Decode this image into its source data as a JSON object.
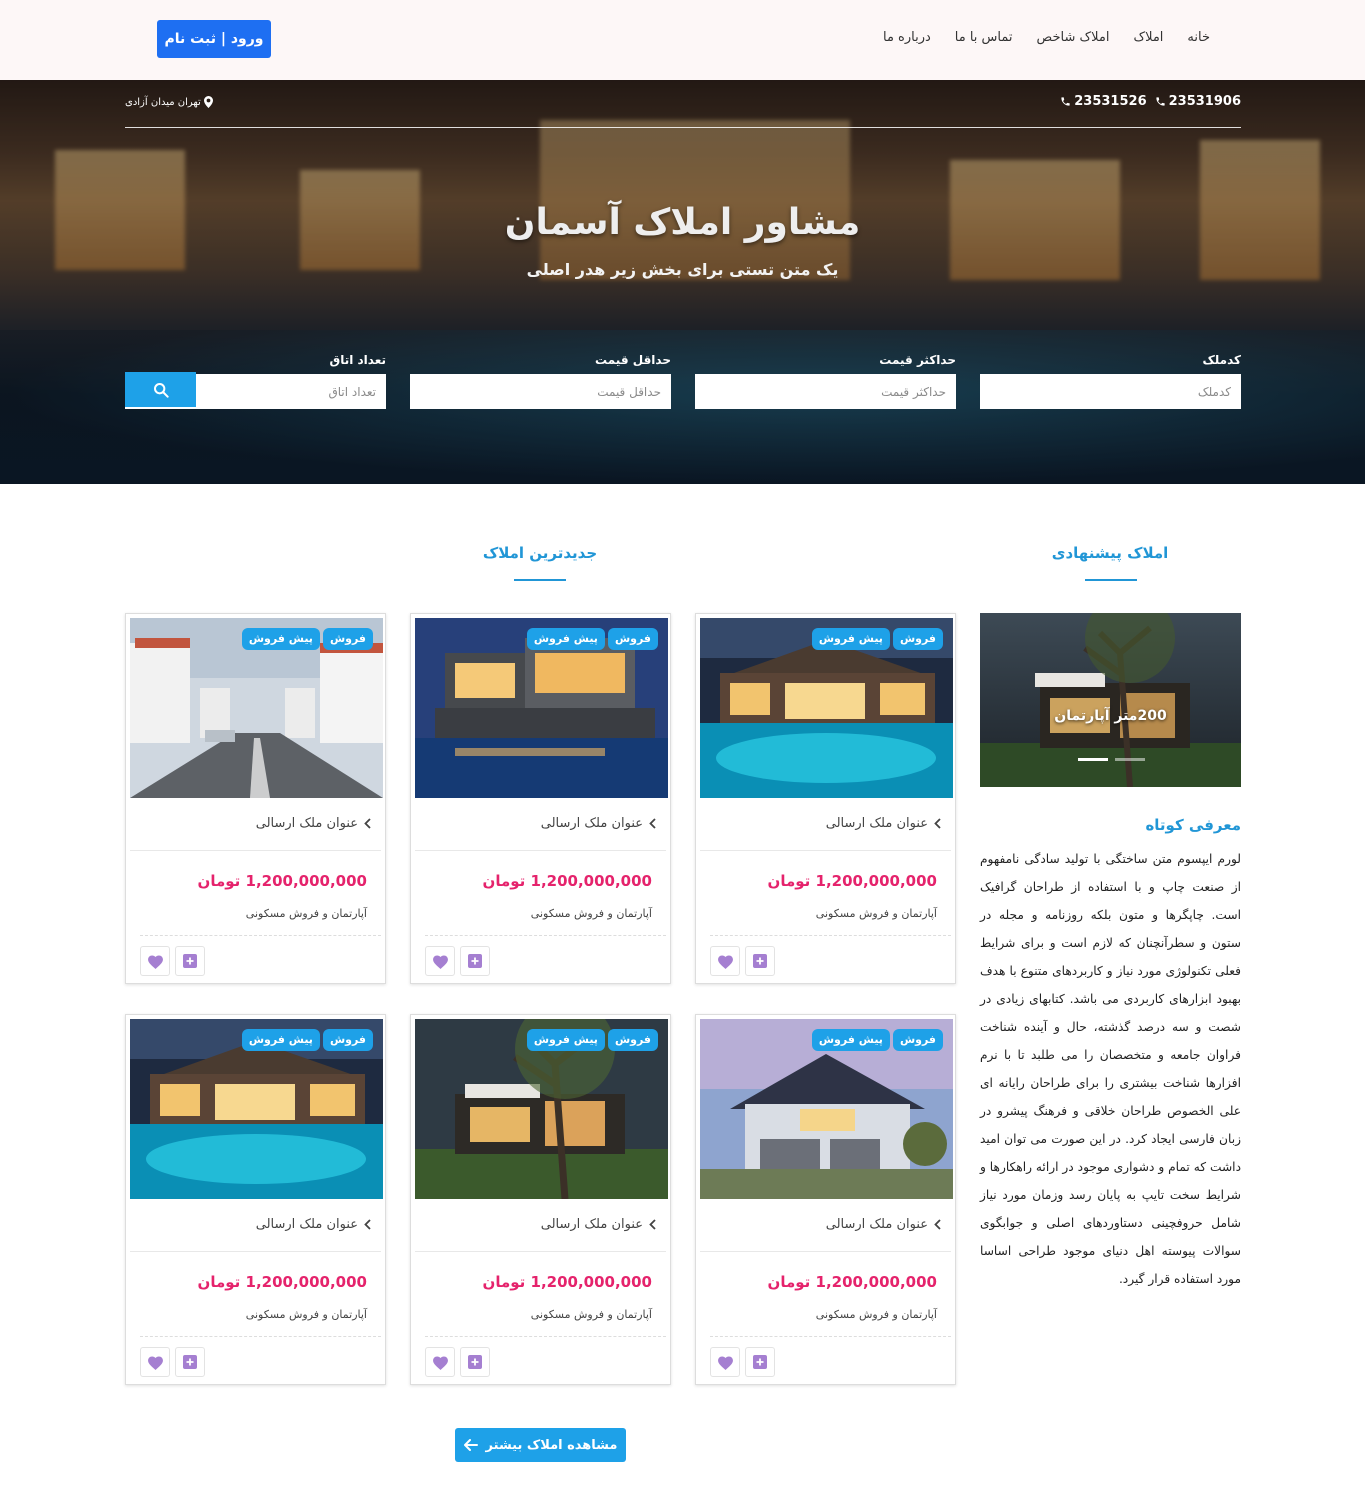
{
  "nav": {
    "items": [
      "خانه",
      "املاک",
      "املاک شاخص",
      "تماس با ما",
      "درباره ما"
    ],
    "login_label": "ورود | ثبت نام"
  },
  "hero": {
    "phones": [
      "23531906",
      "23531526"
    ],
    "address": "تهران میدان آزادی",
    "title": "مشاور املاک آسمان",
    "subtitle": "یک متن تستی برای بخش زیر هدر اصلی",
    "search": {
      "fields": [
        {
          "label": "کدملک",
          "placeholder": "کدملک"
        },
        {
          "label": "حداکثر قیمت",
          "placeholder": "حداکثر قیمت"
        },
        {
          "label": "حداقل قیمت",
          "placeholder": "حداقل قیمت"
        },
        {
          "label": "تعداد اتاق",
          "placeholder": "تعداد اتاق"
        }
      ]
    }
  },
  "sections": {
    "suggested": "املاک پیشنهادی",
    "newest": "جدیدترین املاک"
  },
  "colors": {
    "accent": "#1ea1e8",
    "primary_button": "#1e6ff2",
    "price": "#e5236c",
    "action_icon": "#a57fd1"
  },
  "cards": [
    {
      "scene": "villa-pool",
      "badges": [
        "فروش",
        "پیش فروش"
      ],
      "title": "عنوان ملک ارسالی",
      "price": "1,200,000,000 تومان",
      "type": "آپارتمان و فروش مسکونی"
    },
    {
      "scene": "modern-pool",
      "badges": [
        "فروش",
        "پیش فروش"
      ],
      "title": "عنوان ملک ارسالی",
      "price": "1,200,000,000 تومان",
      "type": "آپارتمان و فروش مسکونی"
    },
    {
      "scene": "white-street",
      "badges": [
        "فروش",
        "پیش فروش"
      ],
      "title": "عنوان ملک ارسالی",
      "price": "1,200,000,000 تومان",
      "type": "آپارتمان و فروش مسکونی"
    },
    {
      "scene": "blue-house",
      "badges": [
        "فروش",
        "پیش فروش"
      ],
      "title": "عنوان ملک ارسالی",
      "price": "1,200,000,000 تومان",
      "type": "آپارتمان و فروش مسکونی"
    },
    {
      "scene": "tree-house",
      "badges": [
        "فروش",
        "پیش فروش"
      ],
      "title": "عنوان ملک ارسالی",
      "price": "1,200,000,000 تومان",
      "type": "آپارتمان و فروش مسکونی"
    },
    {
      "scene": "villa-pool",
      "badges": [
        "فروش",
        "پیش فروش"
      ],
      "title": "عنوان ملک ارسالی",
      "price": "1,200,000,000 تومان",
      "type": "آپارتمان و فروش مسکونی"
    }
  ],
  "slider": {
    "caption": "200متر آپارتمان",
    "slides": 2,
    "active_slide": 2
  },
  "intro": {
    "heading": "معرفی کوتاه",
    "text": "لورم ایپسوم متن ساختگی با تولید سادگی نامفهوم از صنعت چاپ و با استفاده از طراحان گرافیک است. چاپگرها و متون بلکه روزنامه و مجله در ستون و سطرآنچنان که لازم است و برای شرایط فعلی تکنولوژی مورد نیاز و کاربردهای متنوع با هدف بهبود ابزارهای کاربردی می باشد. کتابهای زیادی در شصت و سه درصد گذشته، حال و آینده شناخت فراوان جامعه و متخصصان را می طلبد تا با نرم افزارها شناخت بیشتری را برای طراحان رایانه ای علی الخصوص طراحان خلاقی و فرهنگ پیشرو در زبان فارسی ایجاد کرد. در این صورت می توان امید داشت که تمام و دشواری موجود در ارائه راهکارها و شرایط سخت تایپ به پایان رسد وزمان مورد نیاز شامل حروفچینی دستاوردهای اصلی و جوابگوی سوالات پیوسته اهل دنیای موجود طراحی اساسا مورد استفاده قرار گیرد."
  },
  "more_button": "مشاهده املاک بیشتر"
}
